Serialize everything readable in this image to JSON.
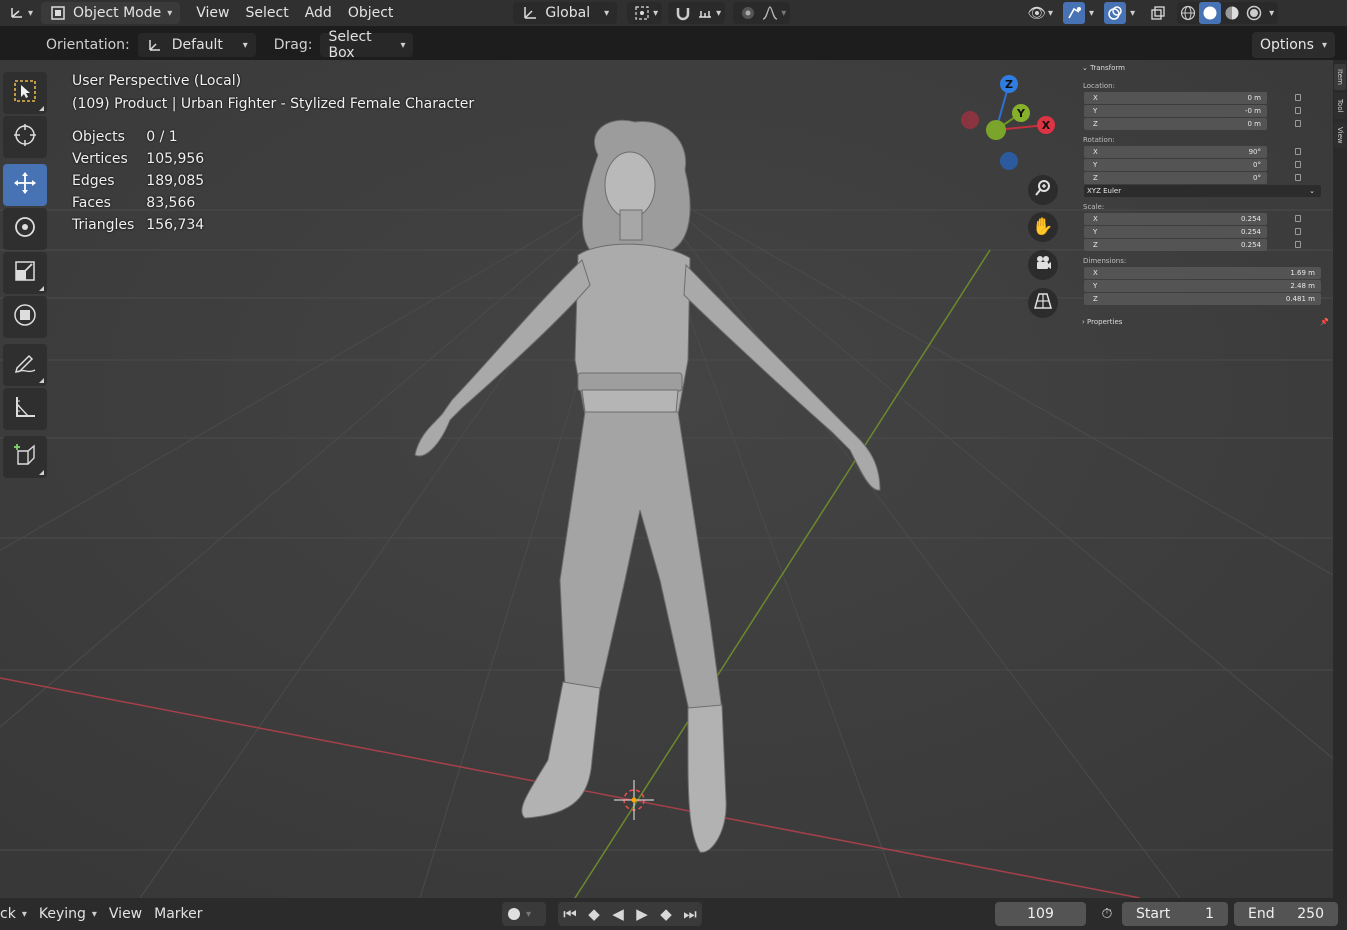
{
  "header": {
    "mode": "Object Mode",
    "menus": [
      "View",
      "Select",
      "Add",
      "Object"
    ],
    "transform_orientation": "Global"
  },
  "tool_settings": {
    "orientation_label": "Orientation:",
    "orientation_value": "Default",
    "drag_label": "Drag:",
    "drag_value": "Select Box",
    "options": "Options"
  },
  "viewport": {
    "view_name": "User Perspective (Local)",
    "object_info": "(109) Product | Urban Fighter - Stylized Female Character",
    "stats": [
      {
        "label": "Objects",
        "value": "0 / 1"
      },
      {
        "label": "Vertices",
        "value": "105,956"
      },
      {
        "label": "Edges",
        "value": "189,085"
      },
      {
        "label": "Faces",
        "value": "83,566"
      },
      {
        "label": "Triangles",
        "value": "156,734"
      }
    ],
    "gizmo": {
      "z": "Z",
      "y": "Y",
      "x": "X"
    }
  },
  "npanel": {
    "transform_title": "Transform",
    "location_label": "Location:",
    "location": [
      {
        "axis": "X",
        "value": "0 m"
      },
      {
        "axis": "Y",
        "value": "-0 m"
      },
      {
        "axis": "Z",
        "value": "0 m"
      }
    ],
    "rotation_label": "Rotation:",
    "rotation": [
      {
        "axis": "X",
        "value": "90°"
      },
      {
        "axis": "Y",
        "value": "0°"
      },
      {
        "axis": "Z",
        "value": "0°"
      }
    ],
    "rotation_mode": "XYZ Euler",
    "scale_label": "Scale:",
    "scale": [
      {
        "axis": "X",
        "value": "0.254"
      },
      {
        "axis": "Y",
        "value": "0.254"
      },
      {
        "axis": "Z",
        "value": "0.254"
      }
    ],
    "dimensions_label": "Dimensions:",
    "dimensions": [
      {
        "axis": "X",
        "value": "1.69 m"
      },
      {
        "axis": "Y",
        "value": "2.48 m"
      },
      {
        "axis": "Z",
        "value": "0.481 m"
      }
    ],
    "properties_title": "Properties",
    "tabs": [
      "Item",
      "Tool",
      "View"
    ]
  },
  "timeline": {
    "playback_partial": "ck",
    "keying": "Keying",
    "view": "View",
    "marker": "Marker",
    "current_frame": "109",
    "start_label": "Start",
    "start_value": "1",
    "end_label": "End",
    "end_value": "250"
  }
}
